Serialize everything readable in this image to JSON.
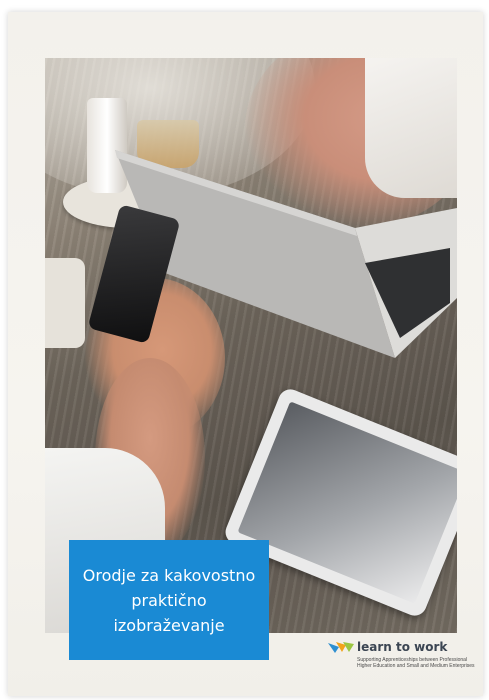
{
  "cover": {
    "title_lines": [
      "Orodje za kakovostno",
      "praktično",
      "izobraževanje"
    ],
    "accent_color": "#1a8ad4"
  },
  "logo": {
    "name": "learn to work",
    "tagline": "Supporting Apprenticeships between Professional Higher Education and Small and Medium Enterprises",
    "colors": [
      "#f2a31b",
      "#2e8fd0",
      "#9cc641"
    ]
  },
  "photo": {
    "subject": "hands holding smartphone, laptop and tablet on a wooden table"
  }
}
